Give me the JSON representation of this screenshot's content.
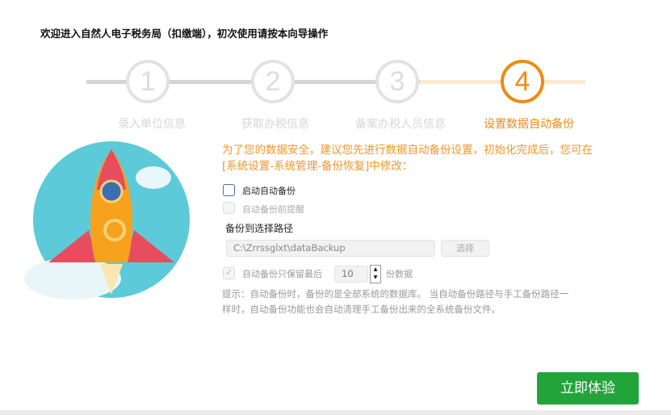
{
  "title": "欢迎进入自然人电子税务局（扣缴端），初次使用请按本向导操作",
  "steps": [
    {
      "num": "1",
      "label": "录入单位信息"
    },
    {
      "num": "2",
      "label": "获取办税信息"
    },
    {
      "num": "3",
      "label": "备案办税人员信息"
    },
    {
      "num": "4",
      "label": "设置数据自动备份"
    }
  ],
  "intro": "为了您的数据安全，建议您先进行数据自动备份设置，初始化完成后，您可在[系统设置-系统管理-备份恢复]中修改：",
  "enable_backup": {
    "label": "启动自动备份",
    "checked": false
  },
  "remind_before": {
    "label": "自动备份前提醒",
    "checked": false
  },
  "path_label": "备份到选择路径",
  "path_value": "C:\\Zrrssglxt\\dataBackup",
  "choose_button": "选择",
  "keep_last": {
    "label": "自动备份只保留最后",
    "value": "10",
    "suffix": "份数据",
    "checked": true
  },
  "hint": "提示：自动备份时，备份的是全部系统的数据库。 当自动备份路径与手工备份路径一样时，自动备份功能也会自动清理手工备份出来的全系统备份文件。",
  "start_button": "立即体验",
  "colors": {
    "accent": "#f08a14",
    "green": "#22a43a"
  }
}
